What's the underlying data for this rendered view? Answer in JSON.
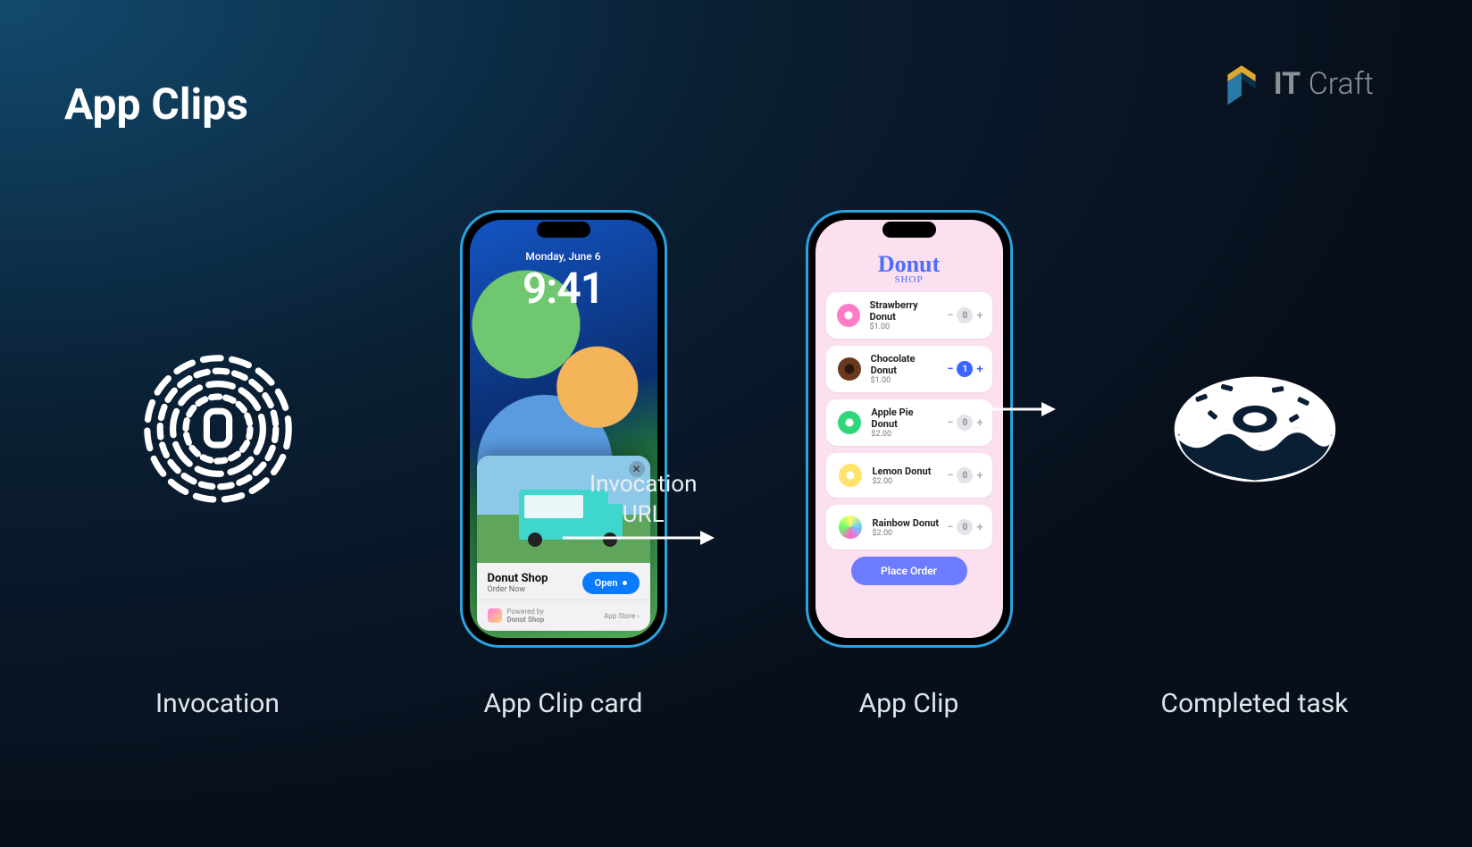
{
  "title": "App Clips",
  "brand": {
    "name_strong": "IT",
    "name_light": "Craft"
  },
  "labels": {
    "invocation": "Invocation",
    "clip_card": "App Clip card",
    "clip": "App Clip",
    "completed": "Completed task"
  },
  "arrow1_label_line1": "Invocation",
  "arrow1_label_line2": "URL",
  "lockscreen": {
    "date": "Monday, June 6",
    "time": "9:41"
  },
  "clip_card": {
    "app_name": "Donut Shop",
    "subtitle": "Order Now",
    "open": "Open",
    "close": "✕",
    "powered_by": "Powered by",
    "powered_app": "Donut Shop",
    "store_link": "App Store ›"
  },
  "shop": {
    "title": "Donut",
    "subtitle": "SHOP",
    "place_order": "Place Order",
    "items": [
      {
        "name": "Strawberry Donut",
        "price": "$1.00",
        "qty": "0",
        "active": false,
        "thumb": "th-straw"
      },
      {
        "name": "Chocolate Donut",
        "price": "$1.00",
        "qty": "1",
        "active": true,
        "thumb": "th-choc"
      },
      {
        "name": "Apple Pie Donut",
        "price": "$2.00",
        "qty": "0",
        "active": false,
        "thumb": "th-apple"
      },
      {
        "name": "Lemon Donut",
        "price": "$2.00",
        "qty": "0",
        "active": false,
        "thumb": "th-lemon"
      },
      {
        "name": "Rainbow Donut",
        "price": "$2.00",
        "qty": "0",
        "active": false,
        "thumb": "th-rain"
      }
    ]
  }
}
